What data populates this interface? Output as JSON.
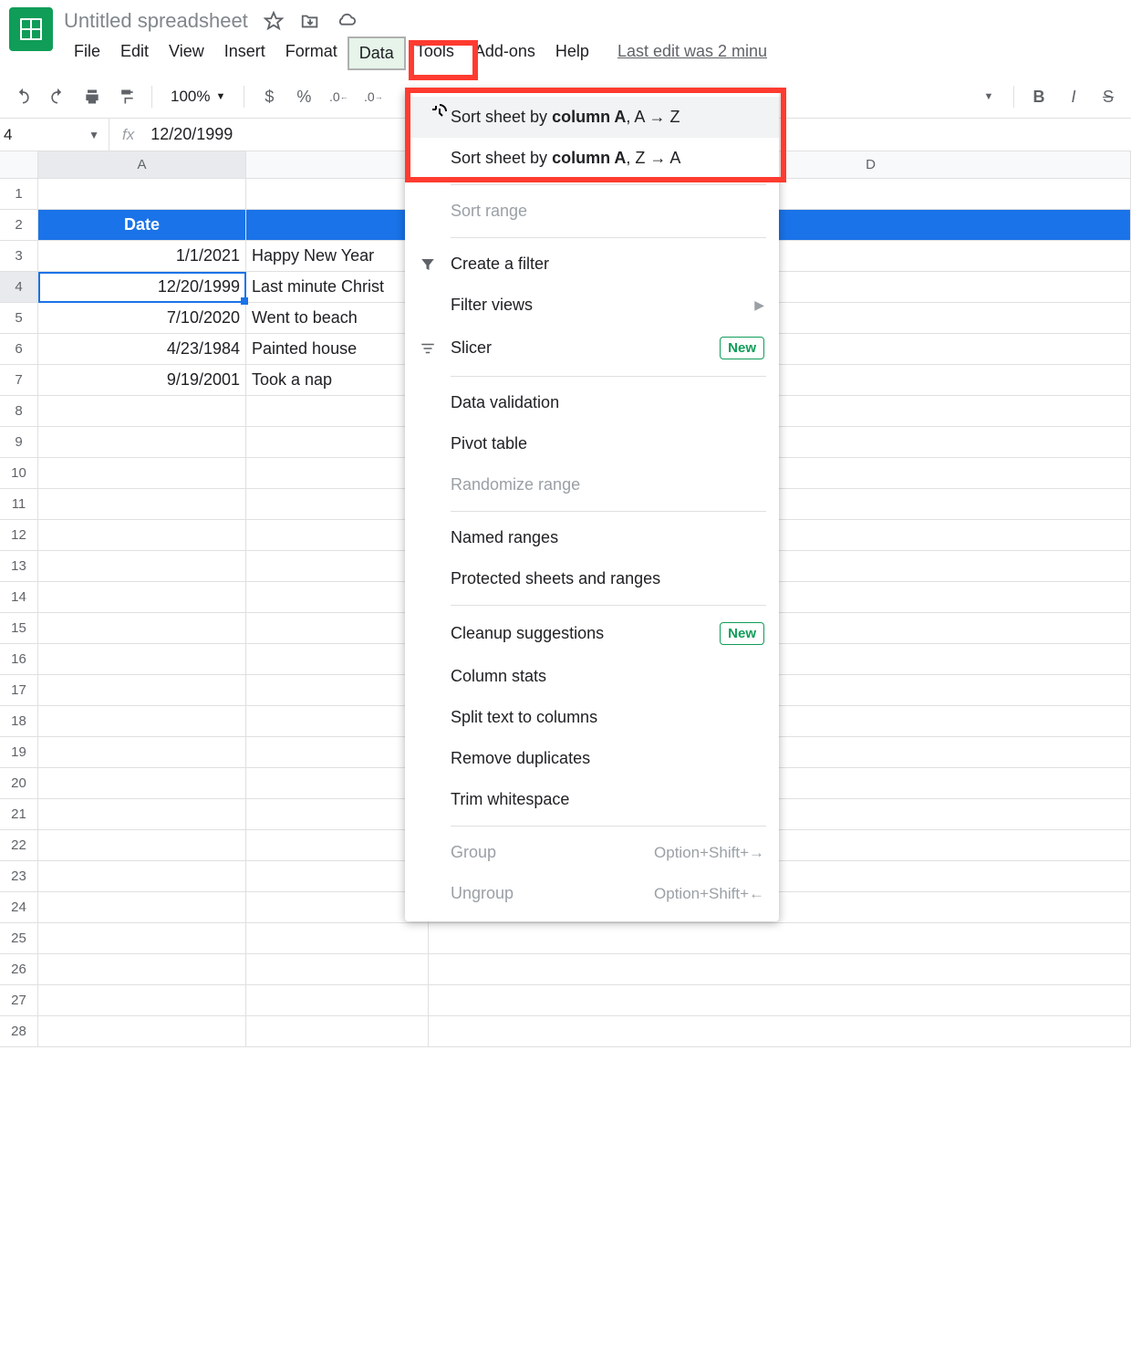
{
  "doc": {
    "title": "Untitled spreadsheet"
  },
  "menubar": {
    "items": [
      "File",
      "Edit",
      "View",
      "Insert",
      "Format",
      "Data",
      "Tools",
      "Add-ons",
      "Help"
    ],
    "last_edit": "Last edit was 2 minu"
  },
  "toolbar": {
    "zoom": "100%",
    "currency": "$",
    "percent": "%",
    "dec_dec": ".0",
    "dec_inc": ".0"
  },
  "formula": {
    "cell": "4",
    "fx": "fx",
    "value": "12/20/1999"
  },
  "columns": [
    "A",
    "D"
  ],
  "rows": {
    "count": 28,
    "header_row": {
      "A": "Date"
    },
    "data": [
      {
        "A": "1/1/2021",
        "B": "Happy New Year"
      },
      {
        "A": "12/20/1999",
        "B": "Last minute Christ"
      },
      {
        "A": "7/10/2020",
        "B": "Went to beach"
      },
      {
        "A": "4/23/1984",
        "B": "Painted house"
      },
      {
        "A": "9/19/2001",
        "B": "Took a nap"
      }
    ]
  },
  "dropdown": {
    "sort_az_prefix": "Sort sheet by ",
    "sort_az_bold": "column A",
    "sort_az_suffix": ", A → Z",
    "sort_za_prefix": "Sort sheet by ",
    "sort_za_bold": "column A",
    "sort_za_suffix": ", Z → A",
    "sort_range": "Sort range",
    "create_filter": "Create a filter",
    "filter_views": "Filter views",
    "slicer": "Slicer",
    "data_validation": "Data validation",
    "pivot_table": "Pivot table",
    "randomize_range": "Randomize range",
    "named_ranges": "Named ranges",
    "protected": "Protected sheets and ranges",
    "cleanup": "Cleanup suggestions",
    "column_stats": "Column stats",
    "split_text": "Split text to columns",
    "remove_dup": "Remove duplicates",
    "trim": "Trim whitespace",
    "group": "Group",
    "ungroup": "Ungroup",
    "group_sc": "Option+Shift+→",
    "ungroup_sc": "Option+Shift+←",
    "new_badge": "New"
  }
}
